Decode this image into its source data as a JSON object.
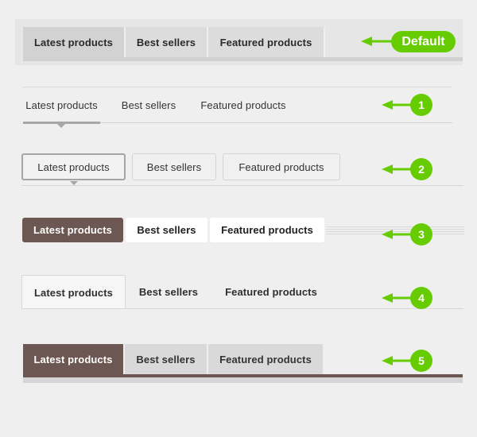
{
  "tab_sets": [
    {
      "id": "default",
      "annotation": "Default",
      "tabs": [
        "Latest products",
        "Best sellers",
        "Featured products"
      ],
      "active_index": 0
    },
    {
      "id": "1",
      "annotation": "1",
      "tabs": [
        "Latest products",
        "Best sellers",
        "Featured products"
      ],
      "active_index": 0
    },
    {
      "id": "2",
      "annotation": "2",
      "tabs": [
        "Latest products",
        "Best sellers",
        "Featured products"
      ],
      "active_index": 0
    },
    {
      "id": "3",
      "annotation": "3",
      "tabs": [
        "Latest products",
        "Best sellers",
        "Featured products"
      ],
      "active_index": 0
    },
    {
      "id": "4",
      "annotation": "4",
      "tabs": [
        "Latest products",
        "Best sellers",
        "Featured products"
      ],
      "active_index": 0
    },
    {
      "id": "5",
      "annotation": "5",
      "tabs": [
        "Latest products",
        "Best sellers",
        "Featured products"
      ],
      "active_index": 0
    }
  ],
  "colors": {
    "annotation_green": "#66cc00",
    "brown_active": "#6c5752",
    "background": "#efefef"
  },
  "icons": {
    "annotation_arrow": "arrow-left-icon"
  }
}
